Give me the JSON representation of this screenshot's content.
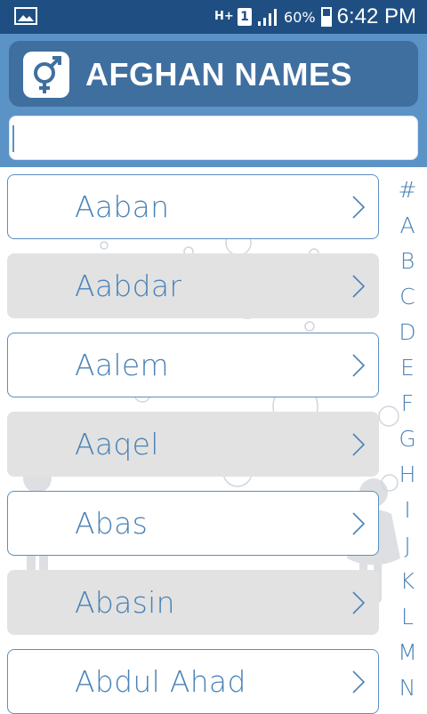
{
  "status_bar": {
    "network": "H+",
    "sim": "1",
    "battery": "60%",
    "time": "6:42 PM",
    "icons": [
      "gallery-icon",
      "signal-icon",
      "battery-icon"
    ]
  },
  "header": {
    "title": "AFGHAN NAMES",
    "icon": "gender-icon"
  },
  "search": {
    "value": "",
    "placeholder": ""
  },
  "names": [
    "Aaban",
    "Aabdar",
    "Aalem",
    "Aaqel",
    "Abas",
    "Abasin",
    "Abdul Ahad"
  ],
  "alphabet": [
    "#",
    "A",
    "B",
    "C",
    "D",
    "E",
    "F",
    "G",
    "H",
    "I",
    "J",
    "K",
    "L",
    "M",
    "N"
  ],
  "colors": {
    "status_bar": "#1f4f82",
    "header_bg": "#5b93c6",
    "title_card": "#3f6f9f",
    "accent_text": "#4a82b6",
    "item_alt_bg": "#e2e2e2"
  }
}
